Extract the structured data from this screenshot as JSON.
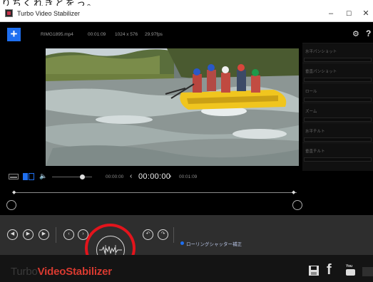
{
  "top_fragment": "りちくれきとをっ。",
  "window": {
    "title": "Turbo Video Stabilizer",
    "controls": [
      "–",
      "☐",
      "✕"
    ]
  },
  "file_info": {
    "name": "RIMG1895.mp4",
    "duration": "00:01:09",
    "resolution": "1024 x 576",
    "fps": "29.97fps"
  },
  "icons": {
    "add": "+",
    "gear": "⚙",
    "help": "?",
    "speaker": "🔈",
    "prev_time": "‹",
    "next_time": "›",
    "play_marker": "◆",
    "facebook": "f",
    "youtube_top": "You",
    "transport": [
      "◀",
      "▶",
      "▶"
    ],
    "step": [
      "‹",
      "›"
    ],
    "rotate": [
      "↶",
      "↷"
    ]
  },
  "adjust_panels": [
    "水平パンショット",
    "垂直パンショット",
    "ロール",
    "ズーム",
    "水平チルト",
    "垂直チルト"
  ],
  "playback": {
    "start_time": "00:00:00",
    "current_time": "00:00:00",
    "end_time": "00:01:09",
    "volume_fraction": 0.72,
    "position_fraction": 0.0
  },
  "rolling_shutter": {
    "label": "ローリングシャッター補正",
    "enabled": true
  },
  "logo": {
    "part1": "Turbo",
    "part2": "VideoStabilizer"
  },
  "colors": {
    "accent_blue": "#1e6ff0",
    "highlight_red": "#e3141c",
    "logo_red": "#d83a30",
    "background": "#000000",
    "control_bar": "#2e2e2e"
  }
}
